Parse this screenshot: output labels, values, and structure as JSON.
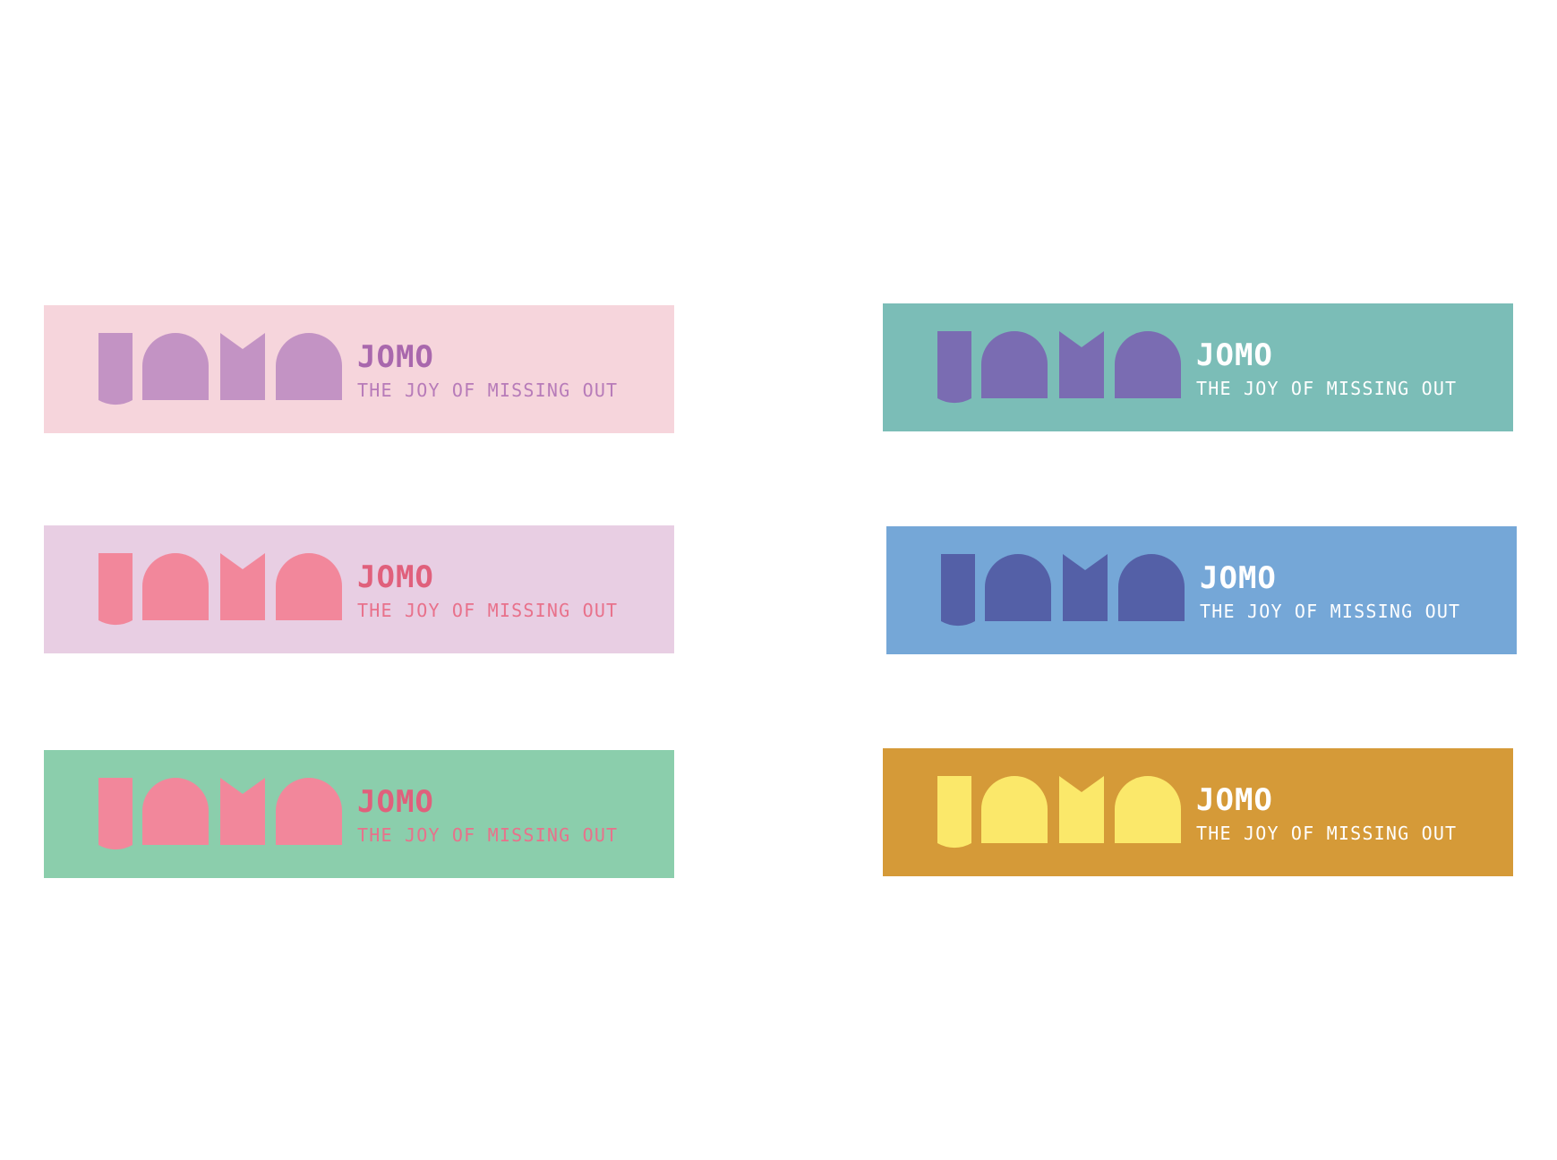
{
  "banners": [
    {
      "brand": "JOMO",
      "tagline": "THE JOY OF MISSING OUT",
      "background": "#f6d5dc",
      "shape_color": "#c393c4",
      "brand_color": "#a968ad",
      "tagline_color": "#b77bb9"
    },
    {
      "brand": "JOMO",
      "tagline": "THE JOY OF MISSING OUT",
      "background": "#7bbdb7",
      "shape_color": "#7a6cb2",
      "brand_color": "#ffffff",
      "tagline_color": "#ffffff"
    },
    {
      "brand": "JOMO",
      "tagline": "THE JOY OF MISSING OUT",
      "background": "#e8cee3",
      "shape_color": "#f2879b",
      "brand_color": "#e0607c",
      "tagline_color": "#e8718b"
    },
    {
      "brand": "JOMO",
      "tagline": "THE JOY OF MISSING OUT",
      "background": "#75a7d7",
      "shape_color": "#5460a7",
      "brand_color": "#ffffff",
      "tagline_color": "#ffffff"
    },
    {
      "brand": "JOMO",
      "tagline": "THE JOY OF MISSING OUT",
      "background": "#8bceac",
      "shape_color": "#f2879b",
      "brand_color": "#e0607c",
      "tagline_color": "#e8718b"
    },
    {
      "brand": "JOMO",
      "tagline": "THE JOY OF MISSING OUT",
      "background": "#d59a38",
      "shape_color": "#fbe86a",
      "brand_color": "#ffffff",
      "tagline_color": "#ffffff"
    }
  ]
}
